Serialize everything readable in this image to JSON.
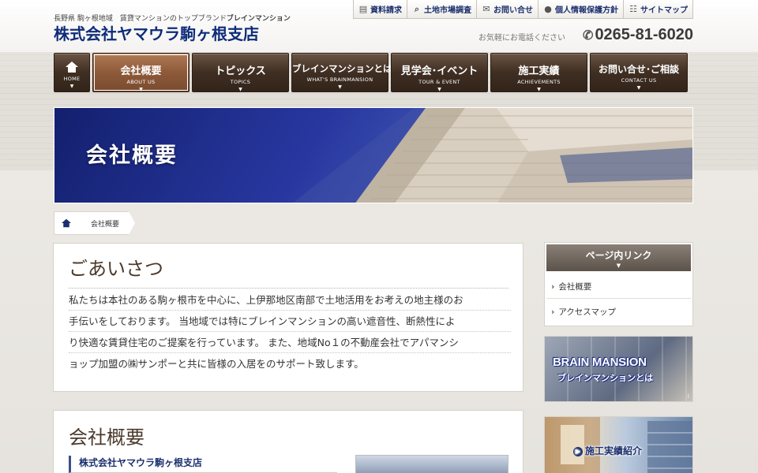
{
  "header": {
    "tagline_prefix": "長野県 駒ヶ根地域　賃貸マンションのトップブランド",
    "tagline_brand": "ブレインマンション",
    "company_name": "株式会社ヤマウラ駒ヶ根支店",
    "phone_label": "お気軽にお電話ください",
    "phone_number": "0265-81-6020"
  },
  "utility_nav": [
    {
      "label": "資料請求",
      "icon": "document-icon"
    },
    {
      "label": "土地市場調査",
      "icon": "search-icon"
    },
    {
      "label": "お問い合せ",
      "icon": "mail-icon"
    },
    {
      "label": "個人情報保護方針",
      "icon": "person-icon"
    },
    {
      "label": "サイトマップ",
      "icon": "sitemap-icon"
    }
  ],
  "main_nav": {
    "home": {
      "label": "HOME"
    },
    "items": [
      {
        "label": "会社概要",
        "sub": "ABOUT US",
        "active": true
      },
      {
        "label": "トピックス",
        "sub": "TOPICS"
      },
      {
        "label": "ブレインマンションとは",
        "sub": "WHAT'S BRAINMANSION"
      },
      {
        "label": "見学会･イベント",
        "sub": "TOUR & EVENT"
      },
      {
        "label": "施工実績",
        "sub": "ACHIEVEMENTS"
      },
      {
        "label": "お問い合せ･ご相談",
        "sub": "CONTACT US"
      }
    ]
  },
  "hero": {
    "title": "会社概要"
  },
  "breadcrumb": {
    "current": "会社概要"
  },
  "greeting": {
    "heading": "ごあいさつ",
    "lines": [
      "私たちは本社のある駒ヶ根市を中心に、上伊那地区南部で土地活用をお考えの地主様のお",
      "手伝いをしております。 当地域では特にブレインマンションの高い遮音性、断熱性によ",
      "り快適な賃貸住宅のご提案を行っています。 また、地域No１の不動産会社でアパマンシ",
      "ョップ加盟の㈱サンポーと共に皆様の入居をのサポート致します。"
    ]
  },
  "profile": {
    "heading": "会社概要",
    "subheading": "株式会社ヤマウラ駒ヶ根支店"
  },
  "sidebar": {
    "links_title": "ページ内リンク",
    "links": [
      "会社概要",
      "アクセスマップ"
    ],
    "brain_banner_en": "BRAIN MANSION",
    "brain_banner_jp": "ブレインマンションとは",
    "works_banner": "施工実績紹介"
  },
  "colors": {
    "brand_blue": "#0e2c7a",
    "nav_brown": "#3f2e22",
    "nav_active": "#8d5a3a"
  }
}
